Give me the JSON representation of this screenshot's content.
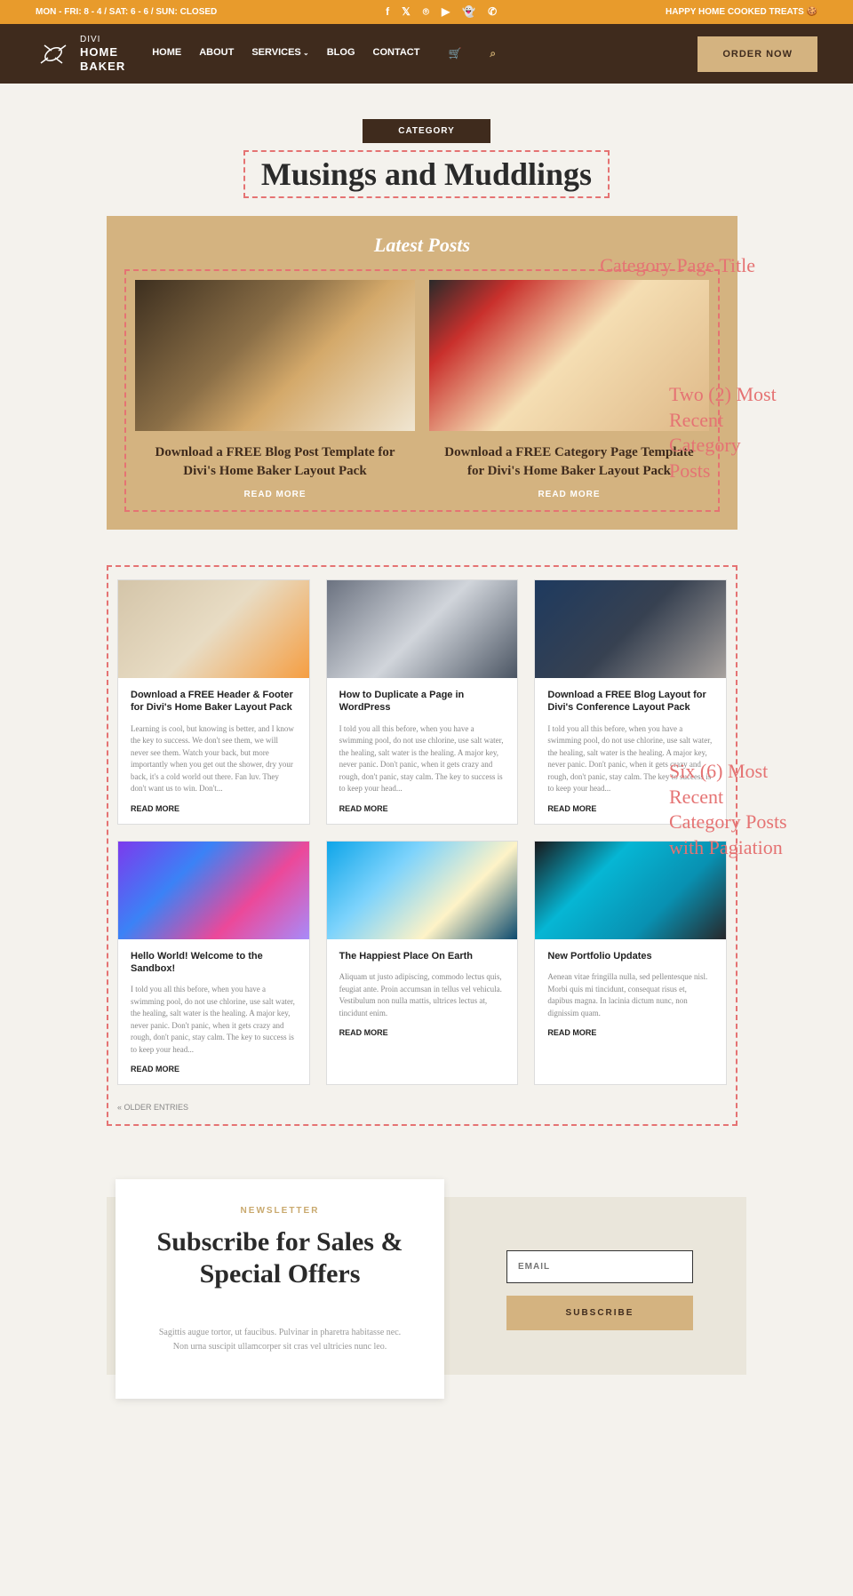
{
  "topbar": {
    "hours": "MON - FRI: 8 - 4 / SAT: 6 - 6 / SUN: CLOSED",
    "announce": "HAPPY HOME COOKED TREATS 🍪"
  },
  "logo": {
    "l1": "DIVI",
    "l2": "HOME",
    "l3": "BAKER"
  },
  "nav": {
    "home": "HOME",
    "about": "ABOUT",
    "services": "SERVICES",
    "blog": "BLOG",
    "contact": "CONTACT"
  },
  "order_btn": "ORDER NOW",
  "cat_label": "CATEGORY",
  "page_title": "Musings and Muddlings",
  "annotations": {
    "a1": "Category Page Title",
    "a2": "Two (2) Most Recent Category Posts",
    "a3": "Six (6) Most Recent Category Posts with Pagiation"
  },
  "latest": {
    "title": "Latest Posts",
    "posts": [
      {
        "title": "Download a FREE Blog Post Template for Divi's Home Baker Layout Pack",
        "rm": "READ MORE"
      },
      {
        "title": "Download a FREE Category Page Template for Divi's Home Baker Layout Pack",
        "rm": "READ MORE"
      }
    ]
  },
  "grid": [
    {
      "title": "Download a FREE Header & Footer for Divi's Home Baker Layout Pack",
      "excerpt": "Learning is cool, but knowing is better, and I know the key to success. We don't see them, we will never see them. Watch your back, but more importantly when you get out the shower, dry your back, it's a cold world out there. Fan luv. They don't want us to win. Don't...",
      "rm": "READ MORE"
    },
    {
      "title": "How to Duplicate a Page in WordPress",
      "excerpt": "I told you all this before, when you have a swimming pool, do not use chlorine, use salt water, the healing, salt water is the healing. A major key, never panic. Don't panic, when it gets crazy and rough, don't panic, stay calm. The key to success is to keep your head...",
      "rm": "READ MORE"
    },
    {
      "title": "Download a FREE Blog Layout for Divi's Conference Layout Pack",
      "excerpt": "I told you all this before, when you have a swimming pool, do not use chlorine, use salt water, the healing, salt water is the healing. A major key, never panic. Don't panic, when it gets crazy and rough, don't panic, stay calm. The key to success is to keep your head...",
      "rm": "READ MORE"
    },
    {
      "title": "Hello World! Welcome to the Sandbox!",
      "excerpt": "I told you all this before, when you have a swimming pool, do not use chlorine, use salt water, the healing, salt water is the healing. A major key, never panic. Don't panic, when it gets crazy and rough, don't panic, stay calm. The key to success is to keep your head...",
      "rm": "READ MORE"
    },
    {
      "title": "The Happiest Place On Earth",
      "excerpt": "Aliquam ut justo adipiscing, commodo lectus quis, feugiat ante. Proin accumsan in tellus vel vehicula. Vestibulum non nulla mattis, ultrices lectus at, tincidunt enim.",
      "rm": "READ MORE"
    },
    {
      "title": "New Portfolio Updates",
      "excerpt": "Aenean vitae fringilla nulla, sed pellentesque nisl. Morbi quis mi tincidunt, consequat risus et, dapibus magna. In lacinia dictum nunc, non dignissim quam.",
      "rm": "READ MORE"
    }
  ],
  "older": "« OLDER ENTRIES",
  "newsletter": {
    "label": "NEWSLETTER",
    "title": "Subscribe for Sales & Special Offers",
    "desc": "Sagittis augue tortor, ut faucibus. Pulvinar in pharetra habitasse nec. Non urna suscipit ullamcorper sit cras vel ultricies nunc leo.",
    "placeholder": "EMAIL",
    "button": "SUBSCRIBE"
  }
}
